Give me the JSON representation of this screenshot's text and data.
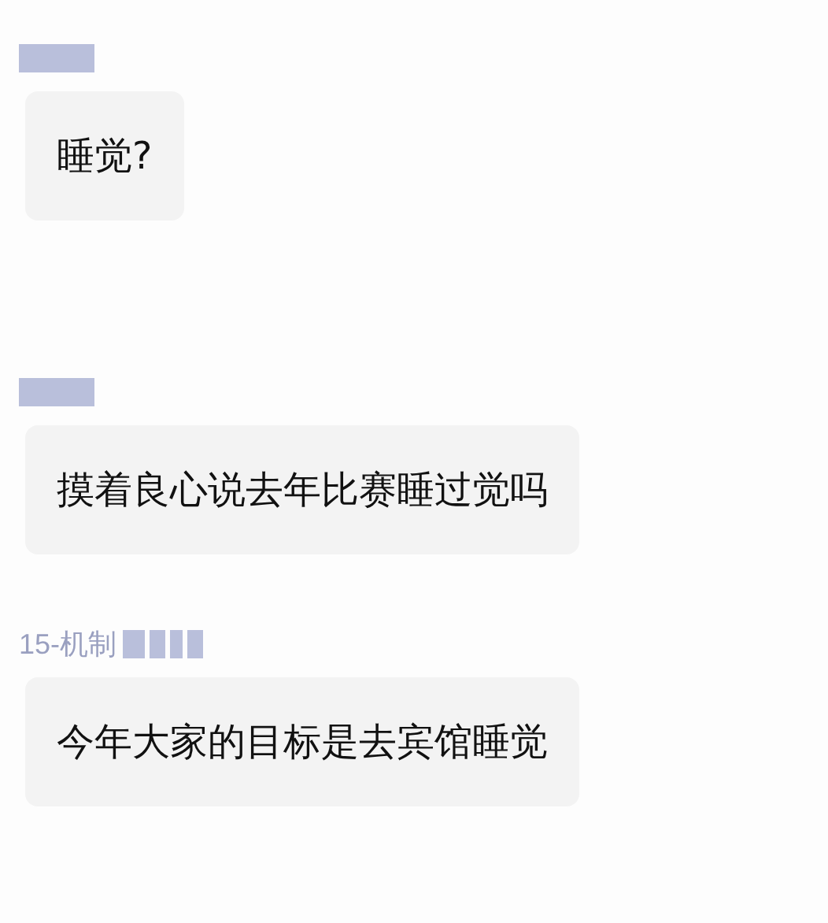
{
  "messages": [
    {
      "sender_redacted": true,
      "text": "睡觉?"
    },
    {
      "sender_redacted": true,
      "text": "摸着良心说去年比赛睡过觉吗"
    },
    {
      "sender": "15-机制",
      "sender_redacted": true,
      "text": "今年大家的目标是去宾馆睡觉"
    }
  ]
}
